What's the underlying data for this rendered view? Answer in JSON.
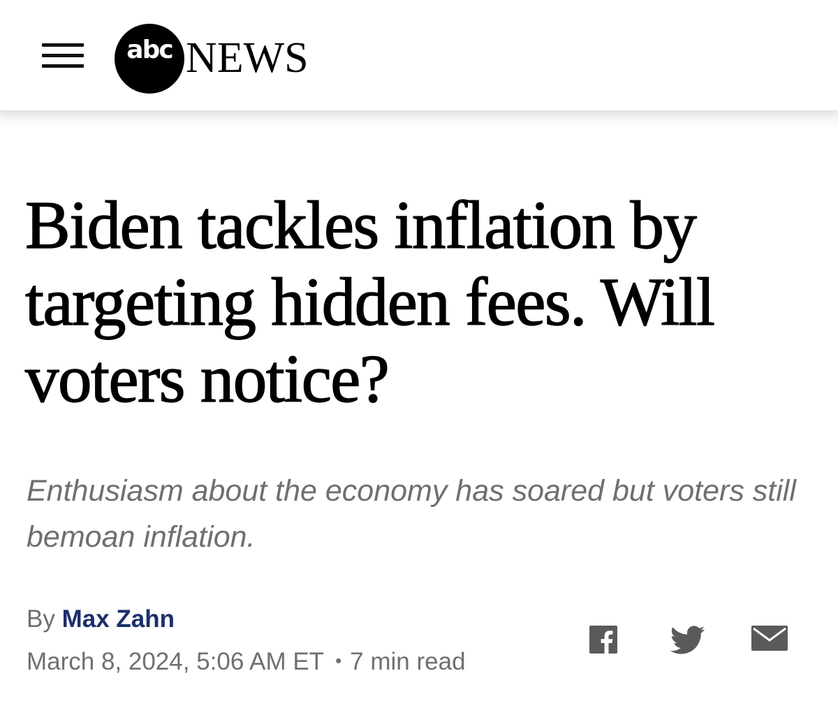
{
  "header": {
    "logo": {
      "brand": "abc",
      "name": "NEWS"
    }
  },
  "article": {
    "headline": "Biden tackles inflation by targeting hidden fees. Will voters notice?",
    "subheadline": "Enthusiasm about the economy has soared but voters still bemoan inflation.",
    "byline_prefix": "By",
    "author": "Max Zahn",
    "date": "March 8, 2024, 5:06 AM ET",
    "separator": "•",
    "read_time": "7 min read"
  },
  "share": {
    "icons": [
      "facebook-icon",
      "twitter-icon",
      "email-icon"
    ]
  },
  "colors": {
    "author_link": "#1b2f6b",
    "muted_text": "#6f6f6f",
    "icon_gray": "#5a5a5a"
  }
}
